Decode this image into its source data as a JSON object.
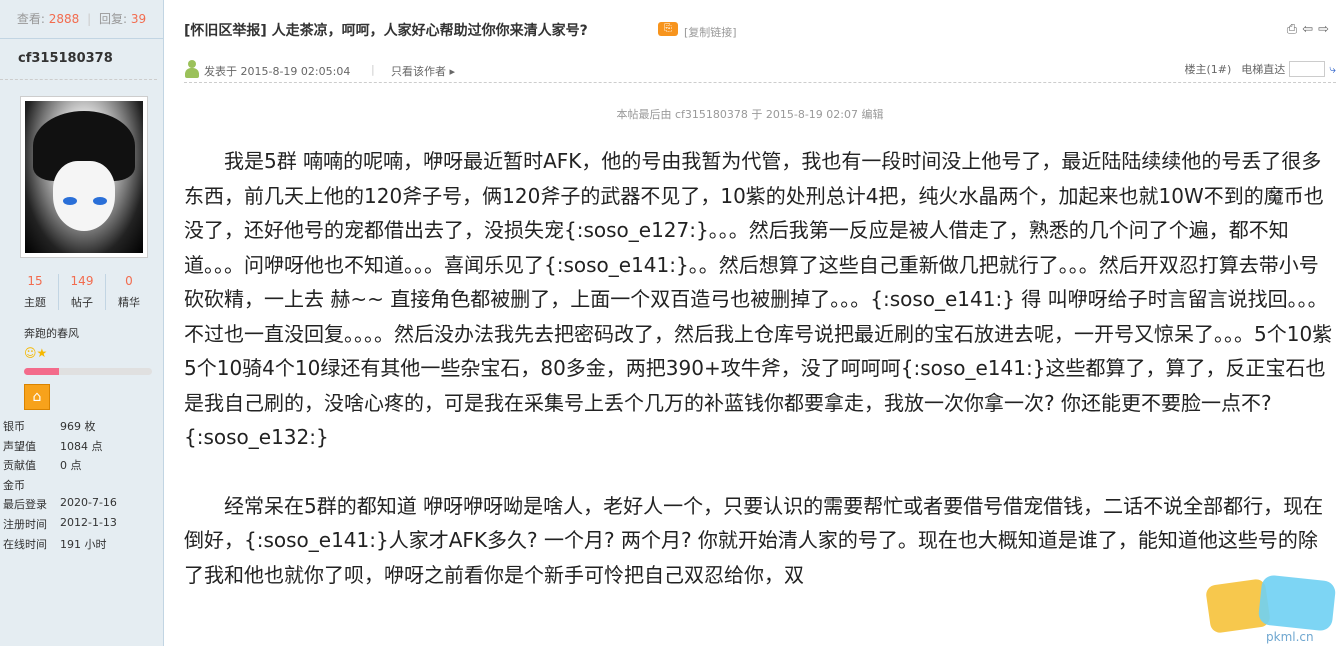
{
  "sidebar": {
    "views_label": "查看:",
    "views": "2888",
    "replies_label": "回复:",
    "replies": "39",
    "author": "cf315180378",
    "counts": [
      {
        "num": "15",
        "label": "主题"
      },
      {
        "num": "149",
        "label": "帖子"
      },
      {
        "num": "0",
        "label": "精华"
      }
    ],
    "group": "奔跑的春风",
    "level_progress_percent": 27,
    "info": [
      {
        "k": "银币",
        "v": "969 枚"
      },
      {
        "k": "声望值",
        "v": "1084 点"
      },
      {
        "k": "贡献值",
        "v": "0 点"
      },
      {
        "k": "金币",
        "v": ""
      },
      {
        "k": "最后登录",
        "v": "2020-7-16"
      },
      {
        "k": "注册时间",
        "v": "2012-1-13"
      },
      {
        "k": "在线时间",
        "v": "191 小时"
      }
    ]
  },
  "post": {
    "tag": "[怀旧区举报]",
    "title": "人走茶凉，呵呵，人家好心帮助过你你来清人家号?",
    "copy_link": "[复制链接]",
    "posted": "发表于 2015-8-19 02:05:04",
    "only_author": "只看该作者",
    "floor": "楼主(1#)",
    "goto": "电梯直达",
    "edited": "本帖最后由 cf315180378 于 2015-8-19 02:07 编辑",
    "para1": "　　我是5群 喃喃的呢喃，咿呀最近暂时AFK，他的号由我暂为代管，我也有一段时间没上他号了，最近陆陆续续他的号丢了很多东西，前几天上他的120斧子号，俩120斧子的武器不见了，10紫的处刑总计4把，纯火水晶两个，加起来也就10W不到的魔币也没了，还好他号的宠都借出去了，没损失宠{:soso_e127:}。。。然后我第一反应是被人借走了，熟悉的几个问了个遍，都不知道。。。问咿呀他也不知道。。。喜闻乐见了{:soso_e141:}。。然后想算了这些自己重新做几把就行了。。。然后开双忍打算去带小号砍砍精，一上去 赫~~ 直接角色都被删了，上面一个双百造弓也被删掉了。。。{:soso_e141:} 得 叫咿呀给子时言留言说找回。。。不过也一直没回复。。。。然后没办法我先去把密码改了，然后我上仓库号说把最近刷的宝石放进去呢，一开号又惊呆了。。。5个10紫5个10骑4个10绿还有其他一些杂宝石，80多金，两把390+攻牛斧，没了呵呵呵{:soso_e141:}这些都算了，算了，反正宝石也是我自己刷的，没啥心疼的，可是我在采集号上丢个几万的补蓝钱你都要拿走，我放一次你拿一次? 你还能更不要脸一点不? {:soso_e132:}",
    "para2": "　　经常呆在5群的都知道 咿呀咿呀呦是啥人，老好人一个，只要认识的需要帮忙或者要借号借宠借钱，二话不说全部都行，现在倒好，{:soso_e141:}人家才AFK多久? 一个月? 两个月? 你就开始清人家的号了。现在也大概知道是谁了，能知道他这些号的除了我和他也就你了呗，咿呀之前看你是个新手可怜把自己双忍给你，双"
  },
  "watermark_text": "pkml.cn"
}
